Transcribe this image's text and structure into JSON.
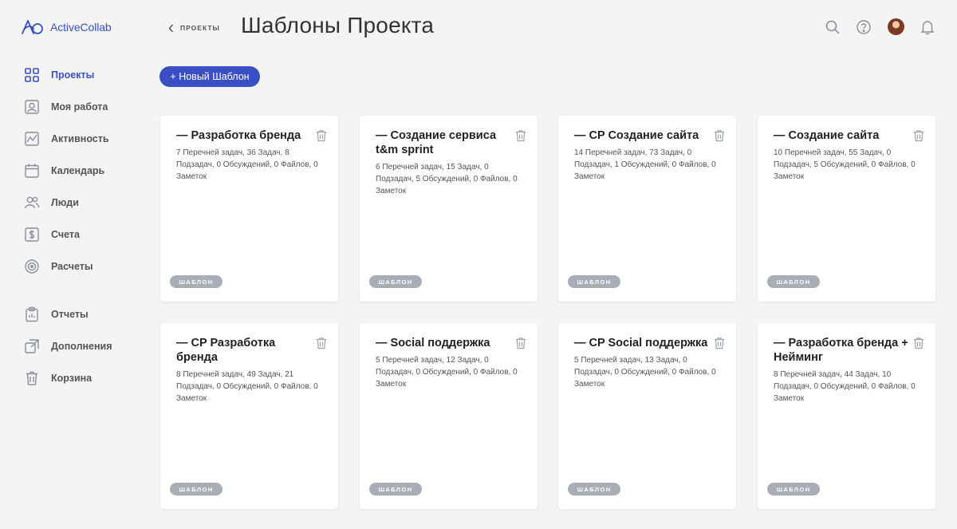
{
  "app": {
    "logo_text": "ActiveCollab"
  },
  "sidebar": {
    "items": [
      {
        "label": "Проекты",
        "icon": "grid-icon",
        "active": true
      },
      {
        "label": "Моя работа",
        "icon": "user-card-icon"
      },
      {
        "label": "Активность",
        "icon": "activity-icon"
      },
      {
        "label": "Календарь",
        "icon": "calendar-icon"
      },
      {
        "label": "Люди",
        "icon": "people-icon"
      },
      {
        "label": "Счета",
        "icon": "dollar-icon"
      },
      {
        "label": "Расчеты",
        "icon": "target-icon"
      },
      {
        "label": "Отчеты",
        "icon": "clipboard-icon"
      },
      {
        "label": "Дополнения",
        "icon": "addon-icon"
      },
      {
        "label": "Корзина",
        "icon": "trash-icon"
      }
    ]
  },
  "header": {
    "breadcrumb": "ПРОЕКТЫ",
    "title": "Шаблоны Проекта"
  },
  "toolbar": {
    "new_template_label": "+ Новый Шаблон"
  },
  "colors": {
    "accent": "#3b4fc4",
    "badge": "#a9aeb6",
    "background": "#f4f4f4"
  },
  "cards": [
    {
      "title": "— Разработка бренда",
      "meta": "7 Перечней задач, 36 Задач, 8 Подзадач, 0 Обсуждений, 0 Файлов, 0 Заметок",
      "badge": "ШАБЛОН"
    },
    {
      "title": "— Создание сервиса t&m sprint",
      "meta": "6 Перечней задач, 15 Задач, 0 Подзадач, 5 Обсуждений, 0 Файлов, 0 Заметок",
      "badge": "ШАБЛОН"
    },
    {
      "title": "— CP Создание сайта",
      "meta": "14 Перечней задач, 73 Задач, 0 Подзадач, 1 Обсуждений, 0 Файлов, 0 Заметок",
      "badge": "ШАБЛОН"
    },
    {
      "title": "— Создание сайта",
      "meta": "10 Перечней задач, 55 Задач, 0 Подзадач, 5 Обсуждений, 0 Файлов, 0 Заметок",
      "badge": "ШАБЛОН"
    },
    {
      "title": "— CP Разработка бренда",
      "meta": "8 Перечней задач, 49 Задач, 21 Подзадач, 0 Обсуждений, 0 Файлов, 0 Заметок",
      "badge": "ШАБЛОН"
    },
    {
      "title": "— Social поддержка",
      "meta": "5 Перечней задач, 12 Задач, 0 Подзадач, 0 Обсуждений, 0 Файлов, 0 Заметок",
      "badge": "ШАБЛОН"
    },
    {
      "title": "— CP Social поддержка",
      "meta": "5 Перечней задач, 13 Задач, 0 Подзадач, 0 Обсуждений, 0 Файлов, 0 Заметок",
      "badge": "ШАБЛОН"
    },
    {
      "title": "— Разработка бренда + Нейминг",
      "meta": "8 Перечней задач, 44 Задач, 10 Подзадач, 0 Обсуждений, 0 Файлов, 0 Заметок",
      "badge": "ШАБЛОН"
    }
  ]
}
